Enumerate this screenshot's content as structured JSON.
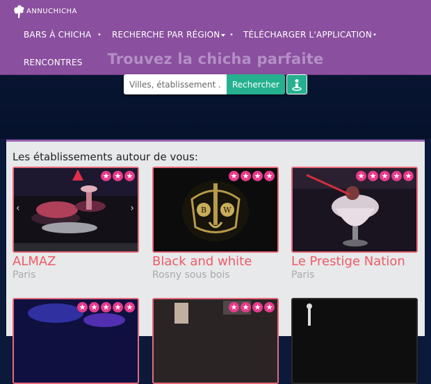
{
  "brand": {
    "name": "ANNUCHICHA"
  },
  "nav": {
    "items": [
      "BARS À CHICHA",
      "RECHERCHE PAR RÉGION",
      "TÉLÉCHARGER L'APPLICATION",
      "RENCONTRES"
    ],
    "separator": "•"
  },
  "hero": {
    "tagline": "Trouvez la chicha parfaite",
    "search_placeholder": "Villes, établissement ...",
    "search_button": "Rechercher",
    "locate_icon": "person-pin-icon"
  },
  "section": {
    "title": "Les établissements autour de vous:",
    "establishments": [
      {
        "name": "ALMAZ",
        "city": "Paris",
        "rating": 3
      },
      {
        "name": "Black and white",
        "city": "Rosny sous bois",
        "rating": 4
      },
      {
        "name": "Le Prestige Nation",
        "city": "Paris",
        "rating": 5
      },
      {
        "name": "",
        "city": "",
        "rating": 5
      },
      {
        "name": "",
        "city": "",
        "rating": 4
      },
      {
        "name": "",
        "city": "",
        "rating": 0
      }
    ]
  },
  "colors": {
    "nav": "#8a4f9e",
    "accent": "#25b18f",
    "star": "#e63b8b",
    "title": "#ef5b65"
  }
}
